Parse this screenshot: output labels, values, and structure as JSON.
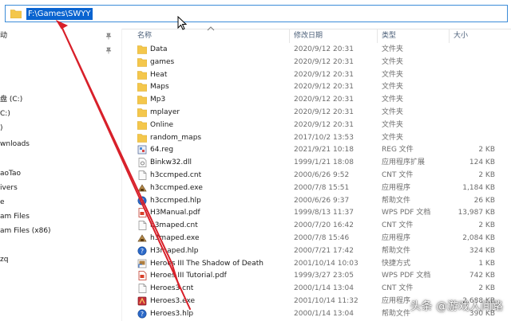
{
  "address_bar": {
    "path": "F:\\Games\\SWYY"
  },
  "nav": {
    "items": [
      {
        "label": "动",
        "pinned": true
      },
      {
        "label": "",
        "pinned": true
      },
      {
        "label": ""
      },
      {
        "label": ""
      },
      {
        "label": "盘 (C:)"
      },
      {
        "label": "C:)"
      },
      {
        "label": ")"
      },
      {
        "label": "wnloads"
      },
      {
        "label": ""
      },
      {
        "label": "aoTao"
      },
      {
        "label": "ivers"
      },
      {
        "label": "e"
      },
      {
        "label": "am Files"
      },
      {
        "label": "am Files (x86)"
      },
      {
        "label": ""
      },
      {
        "label": "zq"
      }
    ]
  },
  "columns": {
    "name": "名称",
    "date": "修改日期",
    "type": "类型",
    "size": "大小"
  },
  "files": [
    {
      "name": "Data",
      "date": "2020/9/12 20:31",
      "type": "文件夹",
      "size": "",
      "icon": "folder-icon"
    },
    {
      "name": "games",
      "date": "2020/9/12 20:31",
      "type": "文件夹",
      "size": "",
      "icon": "folder-icon"
    },
    {
      "name": "Heat",
      "date": "2020/9/12 20:31",
      "type": "文件夹",
      "size": "",
      "icon": "folder-icon"
    },
    {
      "name": "Maps",
      "date": "2020/9/12 20:31",
      "type": "文件夹",
      "size": "",
      "icon": "folder-icon"
    },
    {
      "name": "Mp3",
      "date": "2020/9/12 20:31",
      "type": "文件夹",
      "size": "",
      "icon": "folder-icon"
    },
    {
      "name": "mplayer",
      "date": "2020/9/12 20:31",
      "type": "文件夹",
      "size": "",
      "icon": "folder-icon"
    },
    {
      "name": "Online",
      "date": "2020/9/12 20:31",
      "type": "文件夹",
      "size": "",
      "icon": "folder-icon"
    },
    {
      "name": "random_maps",
      "date": "2017/10/2 13:53",
      "type": "文件夹",
      "size": "",
      "icon": "folder-icon"
    },
    {
      "name": "64.reg",
      "date": "2021/9/21 10:18",
      "type": "REG 文件",
      "size": "2 KB",
      "icon": "registry-file-icon"
    },
    {
      "name": "Binkw32.dll",
      "date": "1999/1/21 18:08",
      "type": "应用程序扩展",
      "size": "124 KB",
      "icon": "dll-file-icon"
    },
    {
      "name": "h3ccmped.cnt",
      "date": "2000/6/26 9:52",
      "type": "CNT 文件",
      "size": "2 KB",
      "icon": "generic-file-icon"
    },
    {
      "name": "h3ccmped.exe",
      "date": "2000/7/8 15:51",
      "type": "应用程序",
      "size": "1,184 KB",
      "icon": "editor-exe-icon"
    },
    {
      "name": "h3ccmped.hlp",
      "date": "2000/6/26 9:37",
      "type": "帮助文件",
      "size": "26 KB",
      "icon": "help-file-icon"
    },
    {
      "name": "H3Manual.pdf",
      "date": "1999/8/13 11:37",
      "type": "WPS PDF 文档",
      "size": "13,987 KB",
      "icon": "pdf-file-icon"
    },
    {
      "name": "h3maped.cnt",
      "date": "2000/7/20 16:42",
      "type": "CNT 文件",
      "size": "2 KB",
      "icon": "generic-file-icon"
    },
    {
      "name": "h3maped.exe",
      "date": "2000/7/8 15:46",
      "type": "应用程序",
      "size": "2,084 KB",
      "icon": "editor-exe-icon"
    },
    {
      "name": "H3maped.hlp",
      "date": "2000/7/21 17:42",
      "type": "帮助文件",
      "size": "324 KB",
      "icon": "help-file-icon"
    },
    {
      "name": "Heroes III The Shadow of Death",
      "date": "2001/10/14 10:03",
      "type": "快捷方式",
      "size": "1 KB",
      "icon": "shortcut-icon"
    },
    {
      "name": "Heroes III Tutorial.pdf",
      "date": "1999/3/27 23:05",
      "type": "WPS PDF 文档",
      "size": "742 KB",
      "icon": "pdf-file-icon"
    },
    {
      "name": "Heroes3.cnt",
      "date": "2000/1/14 13:04",
      "type": "CNT 文件",
      "size": "2 KB",
      "icon": "generic-file-icon"
    },
    {
      "name": "Heroes3.exe",
      "date": "2001/10/14 11:32",
      "type": "应用程序",
      "size": "2,688 KB",
      "icon": "game-exe-icon"
    },
    {
      "name": "Heroes3.hlp",
      "date": "2000/1/14 13:04",
      "type": "帮助文件",
      "size": "390 KB",
      "icon": "help-file-icon"
    }
  ],
  "watermark": "头条 @游戏人间路",
  "colors": {
    "selection": "#0a64d0",
    "folder": "#f4c74c",
    "arrow": "#d8202a",
    "header_text": "#4c607a"
  }
}
